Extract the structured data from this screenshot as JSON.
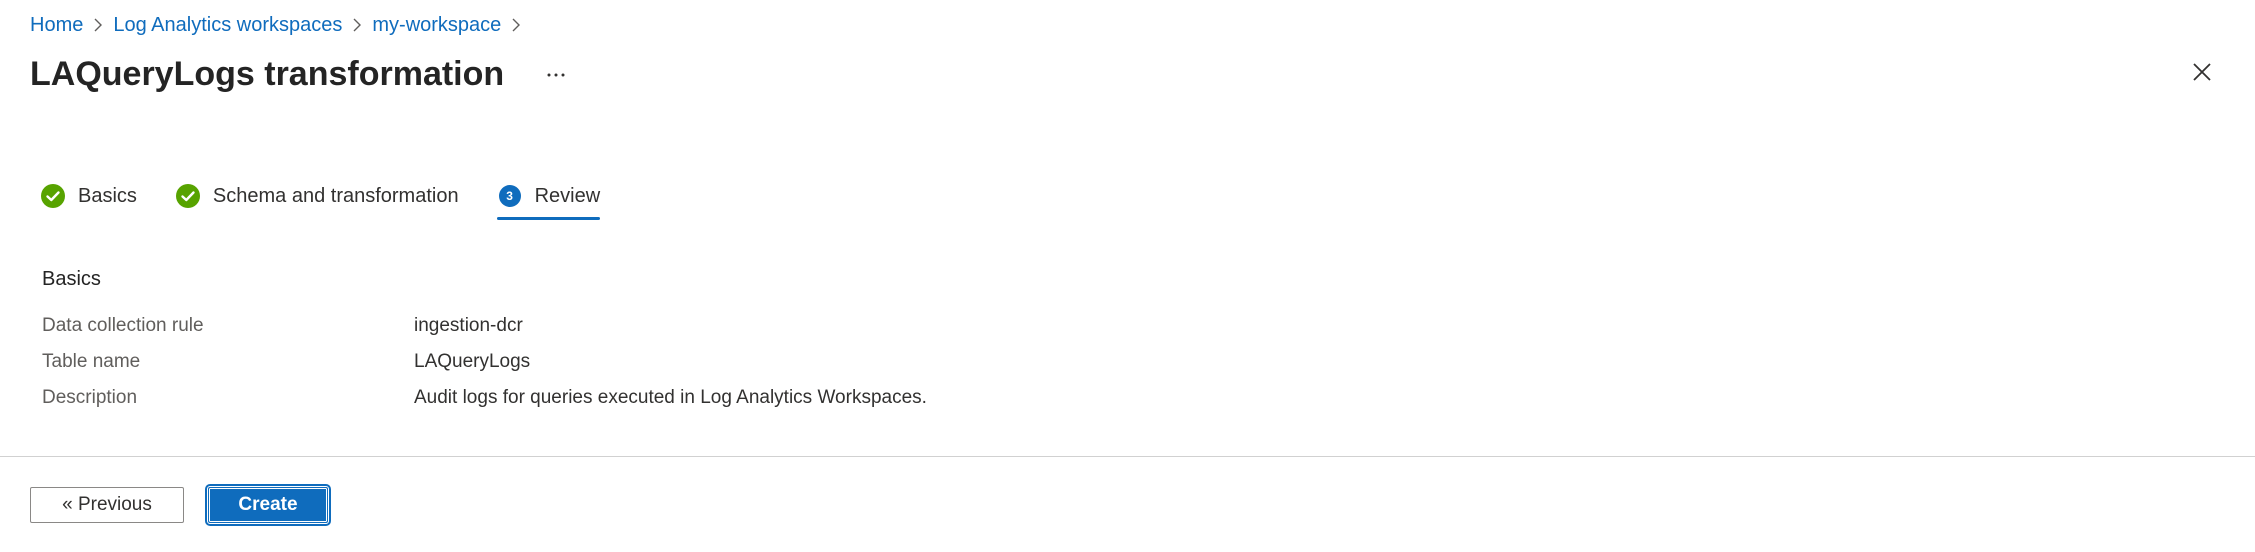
{
  "breadcrumb": {
    "items": [
      "Home",
      "Log Analytics workspaces",
      "my-workspace"
    ]
  },
  "header": {
    "title": "LAQueryLogs transformation",
    "more_icon": "ellipsis-icon",
    "close_icon": "close-icon"
  },
  "tabs": [
    {
      "label": "Basics",
      "status": "complete",
      "icon": "check-circle-icon"
    },
    {
      "label": "Schema and transformation",
      "status": "complete",
      "icon": "check-circle-icon"
    },
    {
      "label": "Review",
      "status": "active",
      "step": "3"
    }
  ],
  "section": {
    "heading": "Basics",
    "rows": [
      {
        "label": "Data collection rule",
        "value": "ingestion-dcr"
      },
      {
        "label": "Table name",
        "value": "LAQueryLogs"
      },
      {
        "label": "Description",
        "value": "Audit logs for queries executed in Log Analytics Workspaces."
      }
    ]
  },
  "footer": {
    "previous_label": "« Previous",
    "create_label": "Create"
  },
  "colors": {
    "accent": "#0f6cbd",
    "success": "#57a300",
    "text": "#323130",
    "muted": "#605e5c"
  }
}
